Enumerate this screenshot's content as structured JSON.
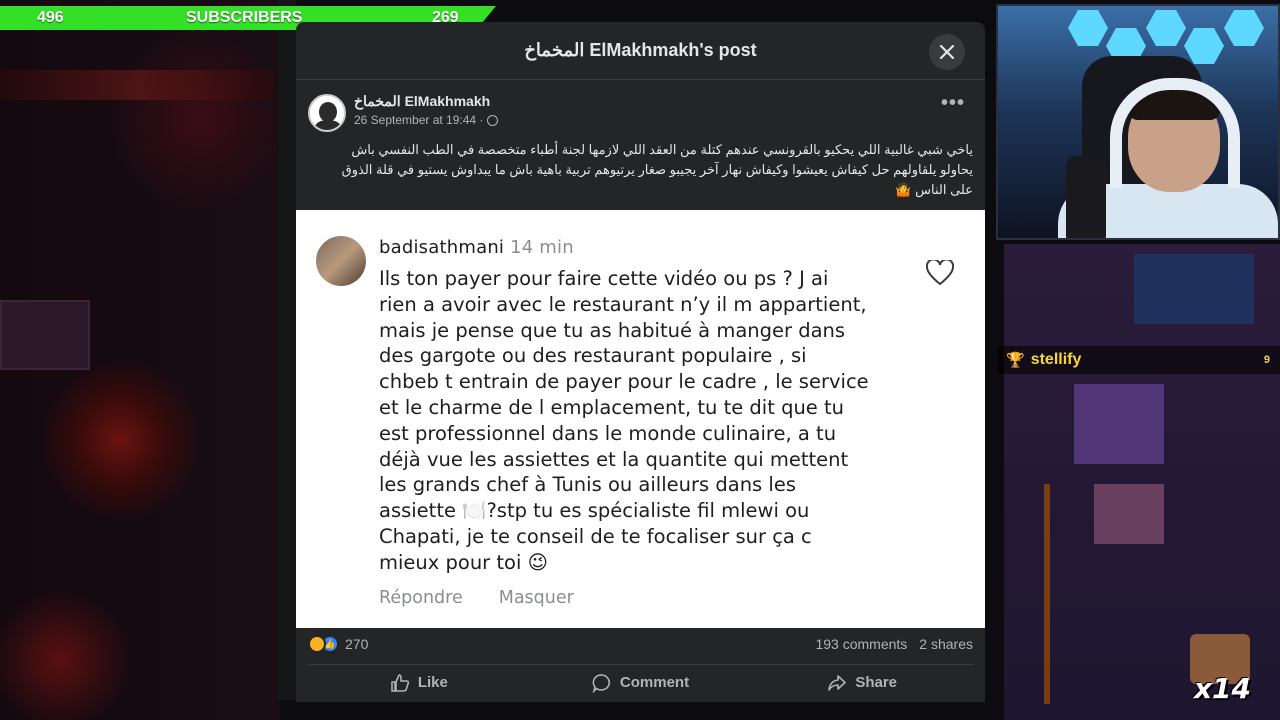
{
  "overlay": {
    "subscribers_left": "496",
    "subscribers_label": "SUBSCRIBERS",
    "subscribers_right": "269",
    "chat_user": "stellify",
    "chat_count": "9",
    "multiplier": "x14"
  },
  "modal": {
    "title": "المخماخ ElMakhmakh's post",
    "close_icon": "close-icon"
  },
  "post": {
    "author": "المخماخ ElMakhmakh",
    "date": "26 September at 19:44 · ",
    "more_icon": "more-dots-icon",
    "text": "ياخي شبي غالبية اللي يحكيو بالقرونسي عندهم كتلة من العقد اللي لازمها لجنة أطباء متخصصة في الطب النفسي باش يحاولو يلقاولهم حل كيفاش يعيشوا وكيفاش نهار آخر يجيبو صغار يرتيوهم تربية باهية باش ما يبداوش يستيو في قلة الذوق على الناس 🤷"
  },
  "comment": {
    "author": "badisathmani",
    "time": "14 min",
    "text": "Ils ton payer pour faire cette vidéo ou ps ? J ai\nrien a avoir avec  le restaurant n’y il m appartient,\nmais je pense que tu as habitué à manger dans\ndes gargote ou des restaurant populaire ,  si\nchbeb t entrain de payer pour le cadre , le service\net le charme de l emplacement, tu te dit que tu\nest professionnel dans le monde culinaire, a tu\ndéjà vue les assiettes et la quantite qui mettent\nles grands  chef à Tunis ou ailleurs dans les\nassiette 🍽️?stp tu es spécialiste fil mlewi ou\nChapati, je te conseil de te focaliser sur ça c\nmieux pour toi 😉",
    "reply_label": "Répondre",
    "hide_label": "Masquer",
    "like_icon": "heart-icon"
  },
  "stats": {
    "reactions": "270",
    "comments": "193 comments",
    "shares": "2 shares"
  },
  "actions": {
    "like": "Like",
    "comment": "Comment",
    "share": "Share"
  }
}
